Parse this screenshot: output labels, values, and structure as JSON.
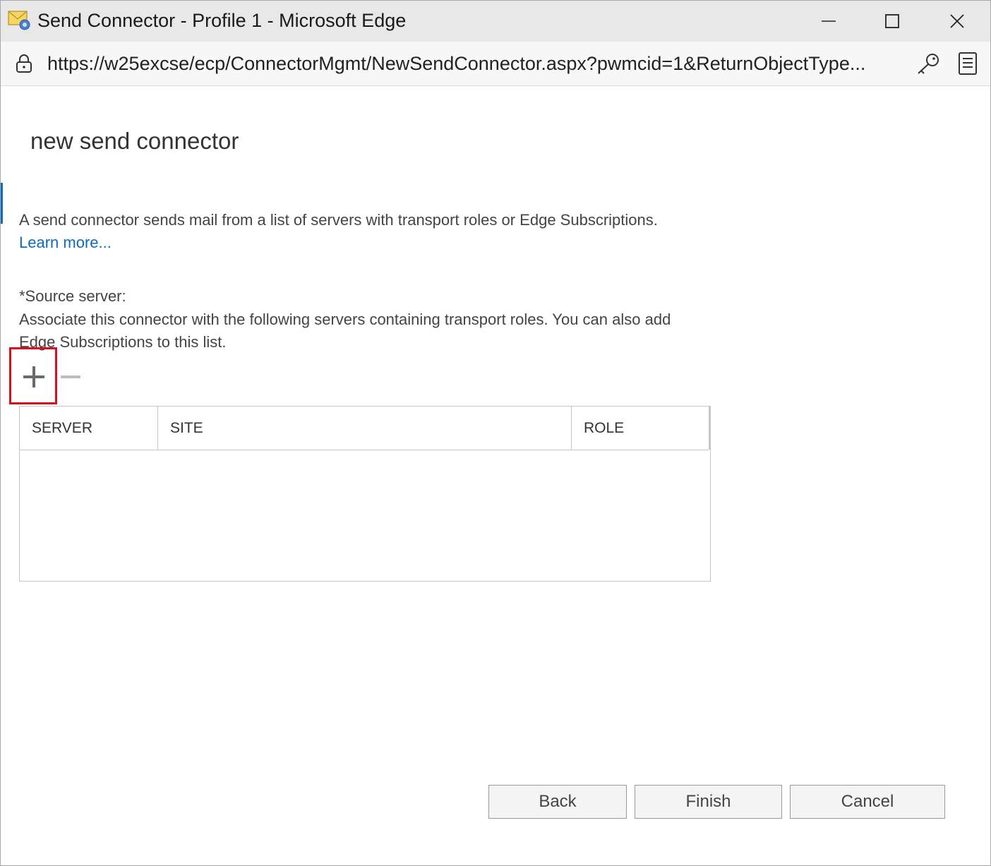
{
  "window": {
    "title": "Send Connector - Profile 1 - Microsoft Edge"
  },
  "addressbar": {
    "url": "https://w25excse/ecp/ConnectorMgmt/NewSendConnector.aspx?pwmcid=1&ReturnObjectType..."
  },
  "page": {
    "title": "new send connector",
    "description": "A send connector sends mail from a list of servers with transport roles or Edge Subscriptions.",
    "learn_more": "Learn more...",
    "source_server_label": "*Source server:",
    "source_server_description": "Associate this connector with the following servers containing transport roles. You can also add Edge Subscriptions to this list."
  },
  "grid": {
    "columns": [
      "SERVER",
      "SITE",
      "ROLE"
    ],
    "rows": []
  },
  "buttons": {
    "back": "Back",
    "finish": "Finish",
    "cancel": "Cancel"
  },
  "colors": {
    "accent": "#0f6cbd",
    "highlight": "#d90e1c"
  }
}
